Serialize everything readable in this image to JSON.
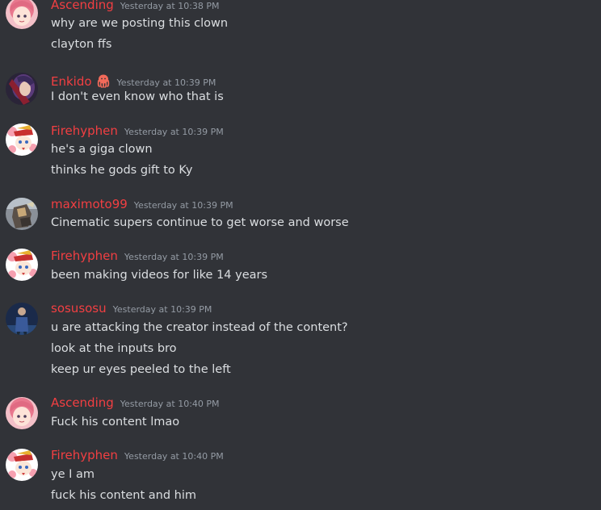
{
  "messages": [
    {
      "user": "Ascending",
      "time": "Yesterday at 10:38 PM",
      "avatar": "pink-hair-girl-avatar",
      "lines": [
        "why are we posting this clown",
        "clayton ffs"
      ]
    },
    {
      "user": "Enkido",
      "time": "Yesterday at 10:39 PM",
      "avatar": "dark-purple-avatar",
      "badge": "octopus-icon",
      "lines": [
        "I don't even know who that is"
      ]
    },
    {
      "user": "Firehyphen",
      "time": "Yesterday at 10:39 PM",
      "avatar": "cherry-blossom-character-avatar",
      "lines": [
        "he's a giga clown",
        "thinks he gods gift to Ky"
      ]
    },
    {
      "user": "maximoto99",
      "time": "Yesterday at 10:39 PM",
      "avatar": "armored-character-avatar",
      "lines": [
        "Cinematic supers continue to get worse and worse"
      ]
    },
    {
      "user": "Firehyphen",
      "time": "Yesterday at 10:39 PM",
      "avatar": "cherry-blossom-character-avatar",
      "lines": [
        "been making videos for like 14 years"
      ]
    },
    {
      "user": "sosusosu",
      "time": "Yesterday at 10:39 PM",
      "avatar": "blue-figure-avatar",
      "lines": [
        "u are attacking the creator instead of the content?",
        "look at the inputs bro",
        "keep ur eyes peeled to the left"
      ]
    },
    {
      "user": "Ascending",
      "time": "Yesterday at 10:40 PM",
      "avatar": "pink-hair-girl-avatar",
      "lines": [
        "Fuck his content lmao"
      ]
    },
    {
      "user": "Firehyphen",
      "time": "Yesterday at 10:40 PM",
      "avatar": "cherry-blossom-character-avatar",
      "lines": [
        "ye I am",
        "fuck his content and him"
      ]
    }
  ],
  "colors": {
    "background": "#313338",
    "username": "#f23f42",
    "timestamp": "#949ba4",
    "text": "#dbdee1"
  }
}
